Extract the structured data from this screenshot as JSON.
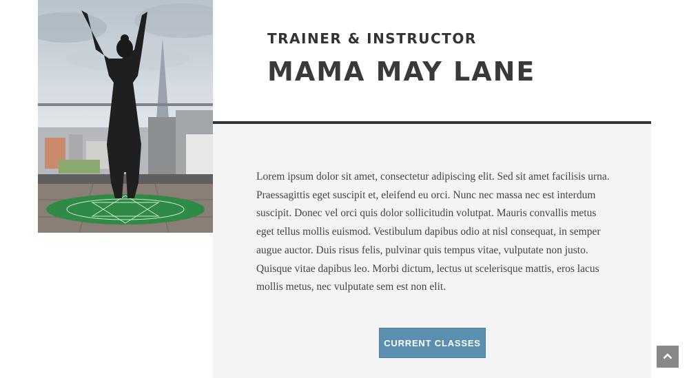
{
  "profile": {
    "role": "TRAINER & INSTRUCTOR",
    "name": "MAMA MAY LANE",
    "bio": "Lorem ipsum dolor sit amet, consectetur adipiscing elit. Sed sit amet facilisis urna. Praessagittis eget suscipit et, eleifend eu orci. Nunc nec massa nec est interdum suscipit. Donec vel orci quis dolor sollicitudin volutpat. Mauris convallis metus eget tellus mollis euismod. Vestibulum dapibus odio at nisl consequat, in semper augue auctor. Duis risus felis, pulvinar quis tempus vitae, vulputate non justo. Quisque vitae dapibus leo. Morbi dictum, lectus ut scelerisque mattis, eros lacus mollis metus, nec vulputate sem est non elit.",
    "cta_label": "CURRENT CLASSES"
  },
  "icons": {
    "scroll_top": "chevron-up-icon"
  },
  "colors": {
    "accent_button": "#5b8fb0",
    "panel_bg": "#f4f4f4",
    "divider": "#333333",
    "scroll_top_bg": "#888888"
  }
}
